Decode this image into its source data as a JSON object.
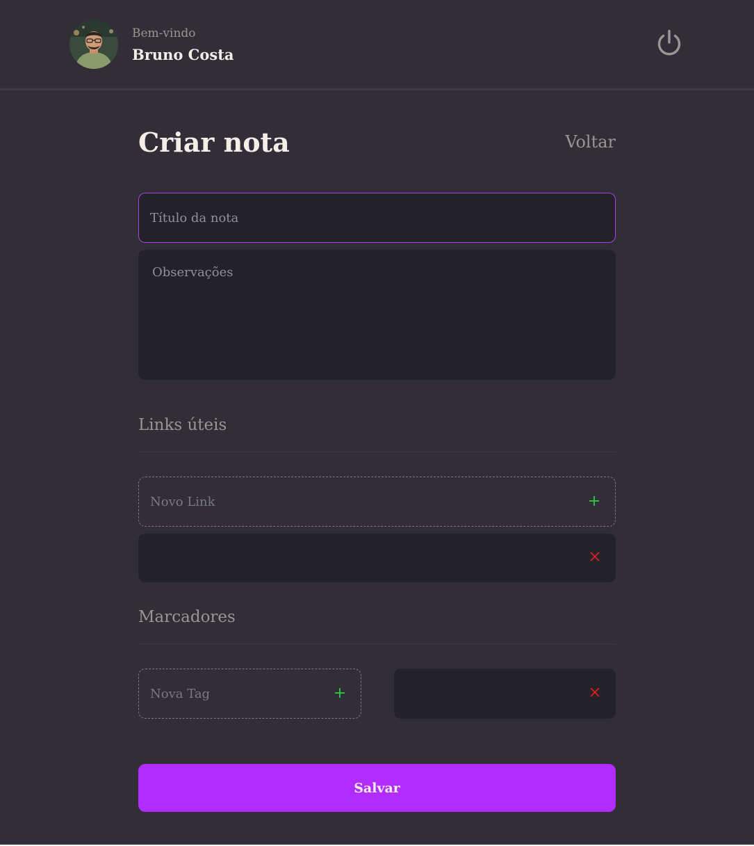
{
  "header": {
    "welcome_label": "Bem-vindo",
    "user_name": "Bruno Costa",
    "power_icon": "power-icon"
  },
  "page": {
    "title": "Criar nota",
    "back_label": "Voltar"
  },
  "form": {
    "title_placeholder": "Título da nota",
    "notes_placeholder": "Observações"
  },
  "links": {
    "section_title": "Links úteis",
    "new_placeholder": "Novo Link",
    "items": [
      ""
    ]
  },
  "tags": {
    "section_title": "Marcadores",
    "new_placeholder": "Nova Tag",
    "items": [
      ""
    ]
  },
  "actions": {
    "save_label": "Salvar"
  },
  "colors": {
    "background": "#312e38",
    "input_background": "#232129",
    "accent": "#b12cff",
    "add_icon": "#2ecc40",
    "remove_icon": "#e02020"
  }
}
